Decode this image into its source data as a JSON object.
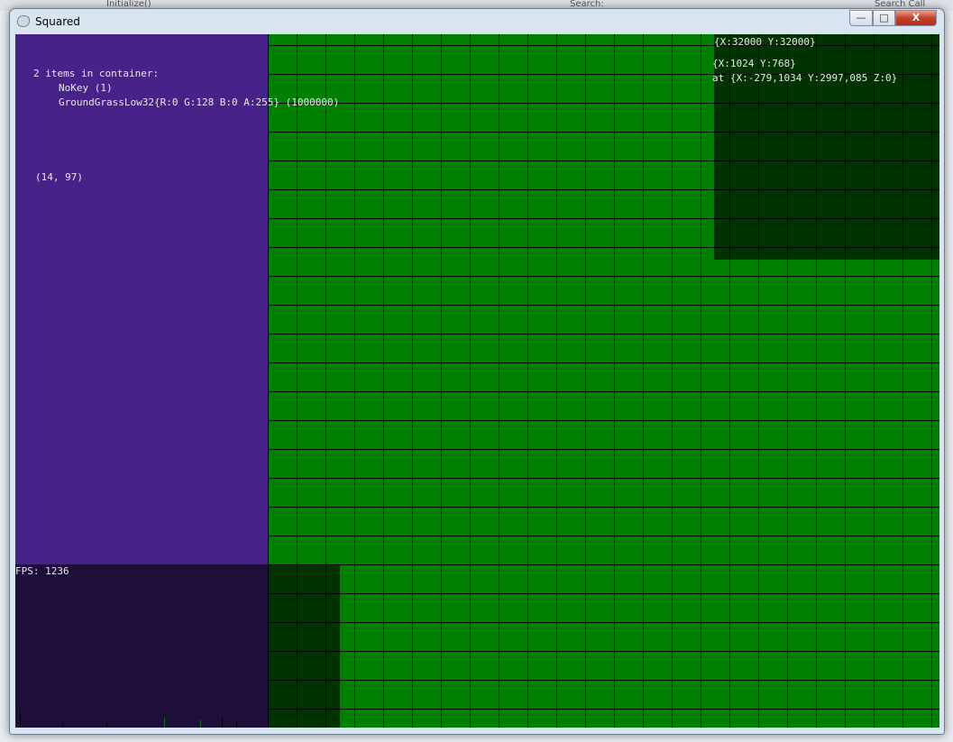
{
  "background": {
    "method": "Initialize()",
    "search_label": "Search:",
    "search_call_stack": "Search Call Stack"
  },
  "window": {
    "title": "Squared",
    "min": "—",
    "max": "□",
    "close": "X"
  },
  "overlay": {
    "container_header": "2 items in container:",
    "items": [
      "NoKey (1)",
      "GroundGrassLow32{R:0 G:128 B:0 A:255} (1000000)"
    ],
    "coords": "(14, 97)",
    "fps": "FPS: 1236",
    "world_size": "{X:32000 Y:32000}",
    "viewport": "{X:1024 Y:768}",
    "camera": "at {X:-279,1034 Y:2997,085 Z:0}"
  }
}
